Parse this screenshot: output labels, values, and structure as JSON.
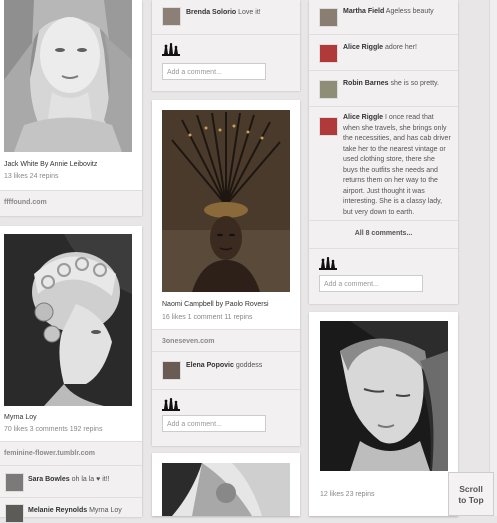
{
  "col1": {
    "pin1": {
      "caption": "Jack White By Annie Leibovitz",
      "stats": "13 likes  24 repins",
      "source": "ffffound.com"
    },
    "pin2": {
      "caption": "Myrna Loy",
      "stats": "70 likes  3 comments  192 repins",
      "source": "feminine-flower.tumblr.com",
      "comment": {
        "user": "Sara Bowles",
        "text": "oh la la ♥ it!!"
      },
      "next_user": "Melanie Reynolds",
      "next_text": "Myrna Loy"
    }
  },
  "col2": {
    "top_comment": {
      "user": "Brenda Solorio",
      "text": "Love it!"
    },
    "top_input_placeholder": "Add a comment...",
    "pin": {
      "caption": "Naomi Campbell by Paolo Roversi",
      "stats": "16 likes  1 comment  11 repins",
      "source": "3oneseven.com",
      "comment": {
        "user": "Elena Popovic",
        "text": "goddess"
      },
      "input_placeholder": "Add a comment..."
    }
  },
  "col3": {
    "comments": [
      {
        "user": "Martha Field",
        "text": "Ageless beauty"
      },
      {
        "user": "Alice Riggle",
        "text": "adore her!"
      },
      {
        "user": "Robin Barnes",
        "text": "she is so pretty."
      },
      {
        "user": "Alice Riggle",
        "text": "I once read that when she travels, she brings only the necessities, and has cab driver take her to the nearest vintage or used clothing store, there she buys the outfits she needs and returns them on her way to the airport. Just thought it was interesting. She is a classy lady, but very down to earth."
      }
    ],
    "all_comments_link": "All 8 comments...",
    "input_placeholder": "Add a comment...",
    "pin": {
      "stats": "12 likes  23 repins"
    }
  },
  "scroll_top": {
    "line1": "Scroll",
    "line2": "to Top"
  }
}
